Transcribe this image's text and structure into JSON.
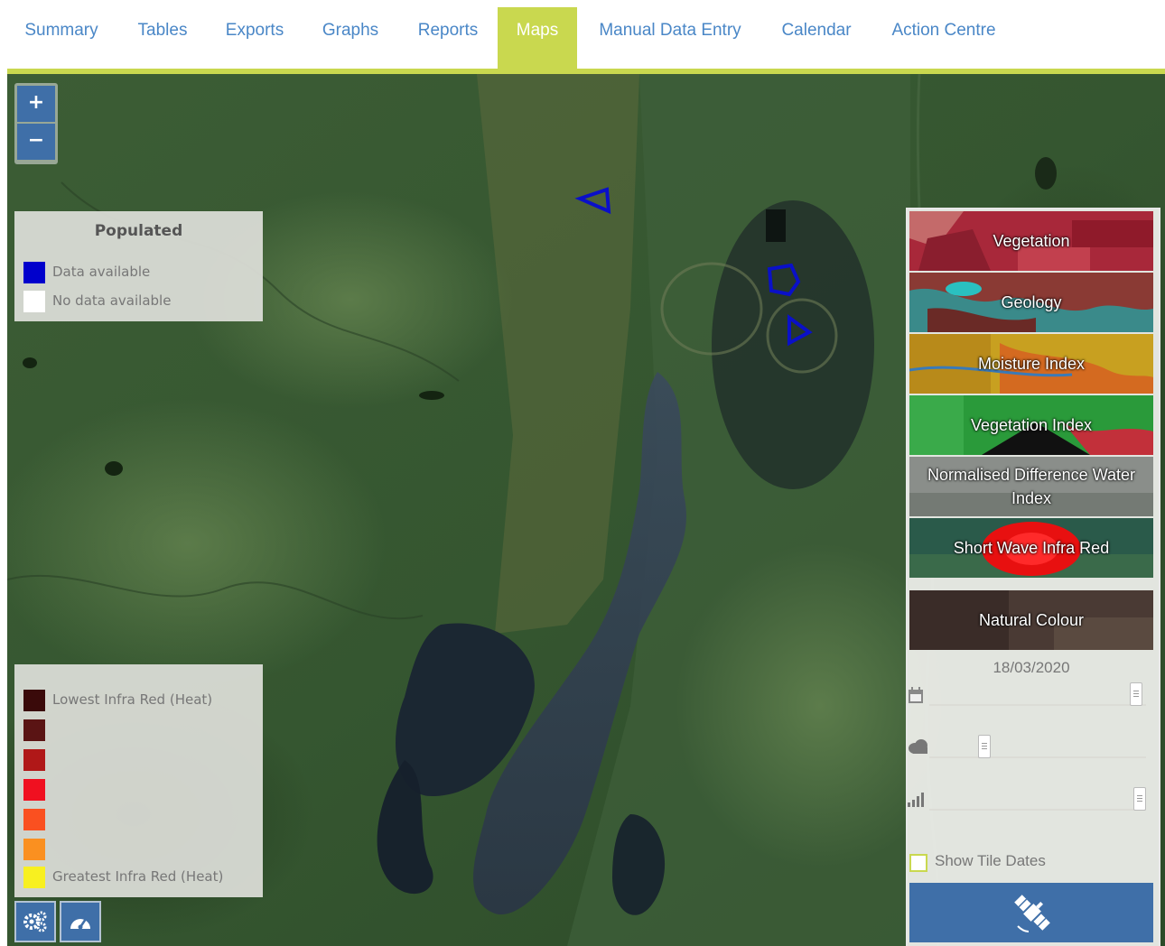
{
  "nav": {
    "tabs": [
      {
        "label": "Summary"
      },
      {
        "label": "Tables"
      },
      {
        "label": "Exports"
      },
      {
        "label": "Graphs"
      },
      {
        "label": "Reports"
      },
      {
        "label": "Maps",
        "active": true
      },
      {
        "label": "Manual Data Entry"
      },
      {
        "label": "Calendar"
      },
      {
        "label": "Action Centre"
      }
    ]
  },
  "map": {
    "zoom": {
      "in_label": "+",
      "out_label": "−"
    },
    "populated_legend": {
      "title": "Populated",
      "items": [
        {
          "label": "Data available",
          "color": "#0000cc"
        },
        {
          "label": "No data available",
          "color": "#ffffff"
        }
      ]
    },
    "heat_legend": {
      "low_label": "Lowest Infra Red (Heat)",
      "high_label": "Greatest Infra Red (Heat)",
      "colors": [
        "#3a0a0a",
        "#5a1414",
        "#b01818",
        "#f01020",
        "#fa5020",
        "#fa9020",
        "#f8f020"
      ]
    },
    "tools": [
      {
        "icon": "settings-gears-icon"
      },
      {
        "icon": "speedometer-icon"
      }
    ],
    "markers_color": "#0a10c8"
  },
  "layers": {
    "items": [
      {
        "name": "Vegetation"
      },
      {
        "name": "Geology"
      },
      {
        "name": "Moisture Index"
      },
      {
        "name": "Vegetation Index"
      },
      {
        "name": "Normalised Difference Water Index"
      },
      {
        "name": "Short Wave Infra Red",
        "selected": true
      },
      {
        "name": "Natural Colour"
      }
    ],
    "date": "18/03/2020",
    "sliders": [
      {
        "icon": "calendar-icon"
      },
      {
        "icon": "cloud-icon"
      },
      {
        "icon": "signal-bars-icon"
      }
    ],
    "show_tile_dates_label": "Show Tile Dates",
    "show_tile_dates_checked": false,
    "apply_icon": "satellite-icon"
  },
  "colors": {
    "accent": "#c9d84f",
    "link": "#4a87c7",
    "button": "#3f6fa8"
  }
}
